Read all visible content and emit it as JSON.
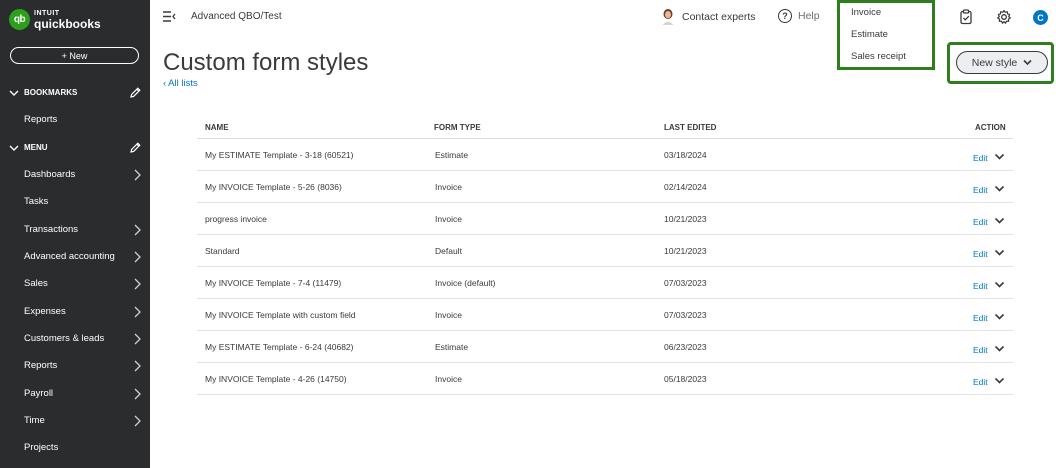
{
  "sidebar": {
    "logo_brand": "INTUIT",
    "logo_product": "quickbooks",
    "logo_mark": "qb",
    "new_label": "+ New",
    "bookmarks_label": "BOOKMARKS",
    "bookmarks": [
      "Reports"
    ],
    "menu_label": "MENU",
    "menu_items": [
      {
        "label": "Dashboards",
        "has_arrow": true
      },
      {
        "label": "Tasks",
        "has_arrow": false
      },
      {
        "label": "Transactions",
        "has_arrow": true
      },
      {
        "label": "Advanced accounting",
        "has_arrow": true
      },
      {
        "label": "Sales",
        "has_arrow": true
      },
      {
        "label": "Expenses",
        "has_arrow": true
      },
      {
        "label": "Customers & leads",
        "has_arrow": true
      },
      {
        "label": "Reports",
        "has_arrow": true
      },
      {
        "label": "Payroll",
        "has_arrow": true
      },
      {
        "label": "Time",
        "has_arrow": true
      },
      {
        "label": "Projects",
        "has_arrow": false
      }
    ]
  },
  "topbar": {
    "company": "Advanced QBO/Test",
    "contact_label": "Contact experts",
    "help_label": "Help",
    "help_glyph": "?",
    "user_initial": "C",
    "icons": [
      "menu-collapse-icon",
      "clipboard-icon",
      "gear-icon"
    ]
  },
  "dropdown": {
    "options": [
      "Invoice",
      "Estimate",
      "Sales receipt"
    ]
  },
  "page": {
    "title": "Custom form styles",
    "back_link": "All lists",
    "new_style_label": "New style"
  },
  "table": {
    "headers": {
      "name": "NAME",
      "form_type": "FORM TYPE",
      "last_edited": "LAST EDITED",
      "action": "ACTION"
    },
    "rows": [
      {
        "name": "My ESTIMATE Template - 3-18 (60521)",
        "form_type": "Estimate",
        "last_edited": "03/18/2024",
        "action": "Edit"
      },
      {
        "name": "My INVOICE Template - 5-26 (8036)",
        "form_type": "Invoice",
        "last_edited": "02/14/2024",
        "action": "Edit"
      },
      {
        "name": "progress invoice",
        "form_type": "Invoice",
        "last_edited": "10/21/2023",
        "action": "Edit"
      },
      {
        "name": "Standard",
        "form_type": "Default",
        "last_edited": "10/21/2023",
        "action": "Edit"
      },
      {
        "name": "My INVOICE Template - 7-4 (11479)",
        "form_type": "Invoice (default)",
        "last_edited": "07/03/2023",
        "action": "Edit"
      },
      {
        "name": "My INVOICE Template with custom field",
        "form_type": "Invoice",
        "last_edited": "07/03/2023",
        "action": "Edit"
      },
      {
        "name": "My ESTIMATE Template - 6-24 (40682)",
        "form_type": "Estimate",
        "last_edited": "06/23/2023",
        "action": "Edit"
      },
      {
        "name": "My INVOICE Template - 4-26 (14750)",
        "form_type": "Invoice",
        "last_edited": "05/18/2023",
        "action": "Edit"
      }
    ]
  },
  "colors": {
    "sidebar_bg": "#2b2c2e",
    "brand_green": "#2ca01c",
    "highlight_green": "#2e7d1e",
    "link_blue": "#0077c5"
  }
}
